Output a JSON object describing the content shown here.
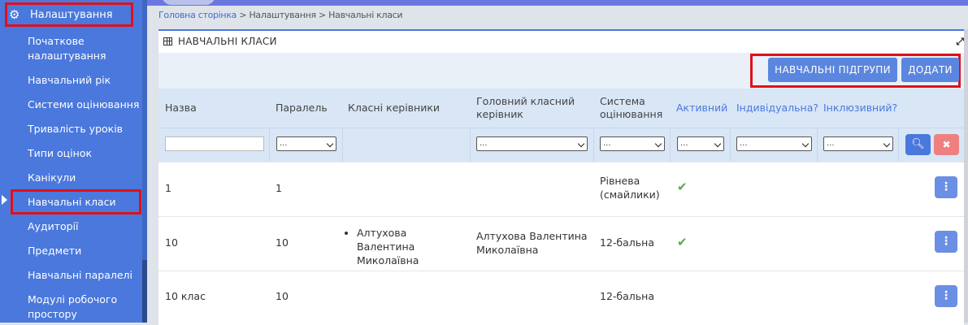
{
  "sidebar": {
    "header_label": "Налаштування",
    "items": [
      {
        "label": "Початкове"
      },
      {
        "label": "налаштування"
      },
      {
        "label": "Навчальний рік"
      },
      {
        "label": "Системи оцінювання"
      },
      {
        "label": "Тривалість уроків"
      },
      {
        "label": "Типи оцінок"
      },
      {
        "label": "Канікули"
      },
      {
        "label": "Навчальні класи"
      },
      {
        "label": "Аудиторії"
      },
      {
        "label": "Предмети"
      },
      {
        "label": "Навчальні паралелі"
      },
      {
        "label": "Модулі робочого"
      },
      {
        "label": "простору"
      }
    ],
    "active_item": "Навчальні класи"
  },
  "breadcrumb": {
    "home": "Головна сторінка",
    "sep1": " > ",
    "settings": "Налаштування",
    "sep2": " > ",
    "current": "Навчальні класи"
  },
  "panel": {
    "title": "НАВЧАЛЬНІ КЛАСИ",
    "subgroups_button": "НАВЧАЛЬНІ ПІДГРУПИ",
    "add_button": "ДОДАТИ"
  },
  "table": {
    "columns": [
      {
        "label": "Назва"
      },
      {
        "label": "Паралель"
      },
      {
        "label": "Класні керівники"
      },
      {
        "label": "Головний класний керівник"
      },
      {
        "label": "Система оцінювання"
      },
      {
        "label": "Активний"
      },
      {
        "label": "Індивідуальна?"
      },
      {
        "label": "Інклюзивний?"
      }
    ],
    "filter_select_value": "...",
    "rows": [
      {
        "name": "1",
        "parallel": "1",
        "teachers": "",
        "head_teacher": "",
        "grading": "Рівнева (смайлики)",
        "active": true
      },
      {
        "name": "10",
        "parallel": "10",
        "teachers": "Алтухова Валентина Миколаївна",
        "head_teacher": "Алтухова Валентина Миколаївна",
        "grading": "12-бальна",
        "active": true
      },
      {
        "name": "10 клас",
        "parallel": "10",
        "teachers": "",
        "head_teacher": "",
        "grading": "12-бальна",
        "active": false
      }
    ]
  },
  "icons": {
    "gear": "gear-icon",
    "grid": "grid-icon",
    "expand": "expand-icon",
    "search": "search-icon",
    "clear": "close-icon",
    "check": "check-icon",
    "menu": "vertical-dots-icon"
  },
  "colors": {
    "sidebar": "#4a78dc",
    "accent_button": "#5b86df",
    "highlight": "#e0101a",
    "check": "#5aa84e",
    "clear": "#f08080"
  }
}
